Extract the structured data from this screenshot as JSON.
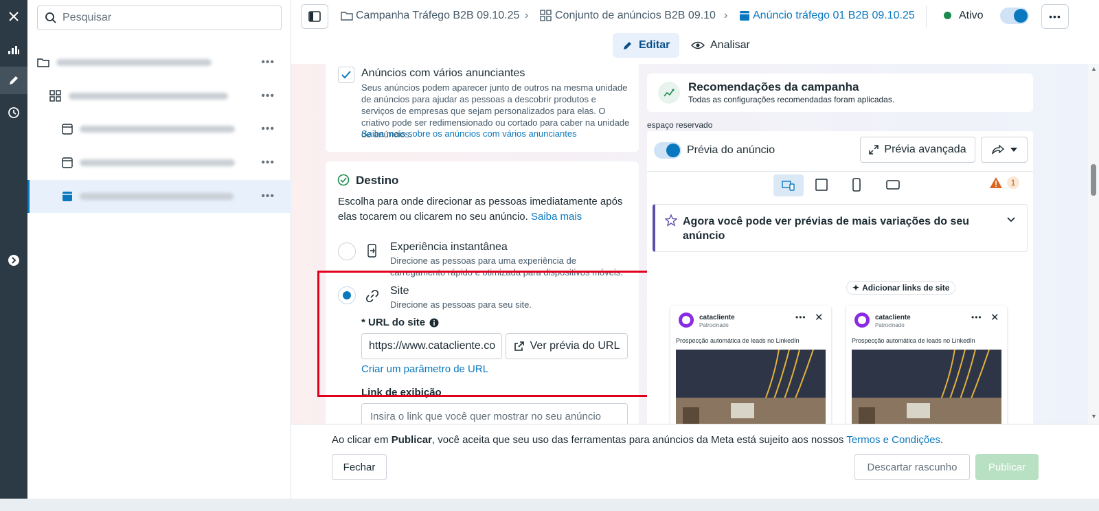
{
  "search": {
    "placeholder": "Pesquisar"
  },
  "breadcrumbs": {
    "campaign": "Campanha Tráfego B2B 09.10.25",
    "adset": "Conjunto de anúncios B2B 09.10",
    "ad": "Anúncio tráfego 01 B2B 09.10.25"
  },
  "status": {
    "label": "Ativo",
    "toggle_on": true
  },
  "tabs": {
    "edit": "Editar",
    "analyze": "Analisar"
  },
  "multi_advertiser": {
    "title": "Anúncios com vários anunciantes",
    "description": "Seus anúncios podem aparecer junto de outros na mesma unidade de anúncios para ajudar as pessoas a descobrir produtos e serviços de empresas que sejam personalizados para elas. O criativo pode ser redimensionado ou cortado para caber na unidade de anúncios.",
    "link": "Saiba mais sobre os anúncios com vários anunciantes",
    "checked": true
  },
  "destination": {
    "title": "Destino",
    "description": "Escolha para onde direcionar as pessoas imediatamente após elas tocarem ou clicarem no seu anúncio.",
    "learn_more": "Saiba mais",
    "options": [
      {
        "title": "Experiência instantânea",
        "desc": "Direcione as pessoas para uma experiência de carregamento rápido e otimizada para dispositivos móveis.",
        "selected": false
      },
      {
        "title": "Site",
        "desc": "Direcione as pessoas para seu site.",
        "selected": true
      }
    ],
    "url_label": "* URL do site",
    "url_value": "https://www.catacliente.co",
    "preview_url_button": "Ver prévia do URL",
    "url_param_link": "Criar um parâmetro de URL",
    "display_link_label": "Link de exibição",
    "display_link_placeholder": "Insira o link que você quer mostrar no seu anúncio"
  },
  "recommendations": {
    "title": "Recomendações da campanha",
    "subtitle": "Todas as configurações recomendadas foram aplicadas."
  },
  "placeholder_label": "espaço reservado",
  "preview": {
    "toggle_label": "Prévia do anúncio",
    "advanced_button": "Prévia avançada",
    "warning_count": "1",
    "banner": "Agora você pode ver prévias de mais variações do seu anúncio",
    "add_links": "Adicionar links de site",
    "posts": [
      {
        "brand": "catacliente",
        "sponsored": "Patrocinado",
        "text": "Prospecção automática de leads no LinkedIn"
      },
      {
        "brand": "catacliente",
        "sponsored": "Patrocinado",
        "text": "Prospecção automática de leads no LinkedIn"
      }
    ]
  },
  "footer": {
    "notice_prefix": "Ao clicar em ",
    "notice_bold": "Publicar",
    "notice_middle": ", você aceita que seu uso das ferramentas para anúncios da Meta está sujeito aos nossos ",
    "notice_link": "Termos e Condições",
    "notice_suffix": ".",
    "close": "Fechar",
    "discard": "Descartar rascunho",
    "publish": "Publicar"
  },
  "colors": {
    "accent": "#0a78be",
    "highlight_box": "#e0001b",
    "publish_disabled": "#b8e0c3"
  }
}
